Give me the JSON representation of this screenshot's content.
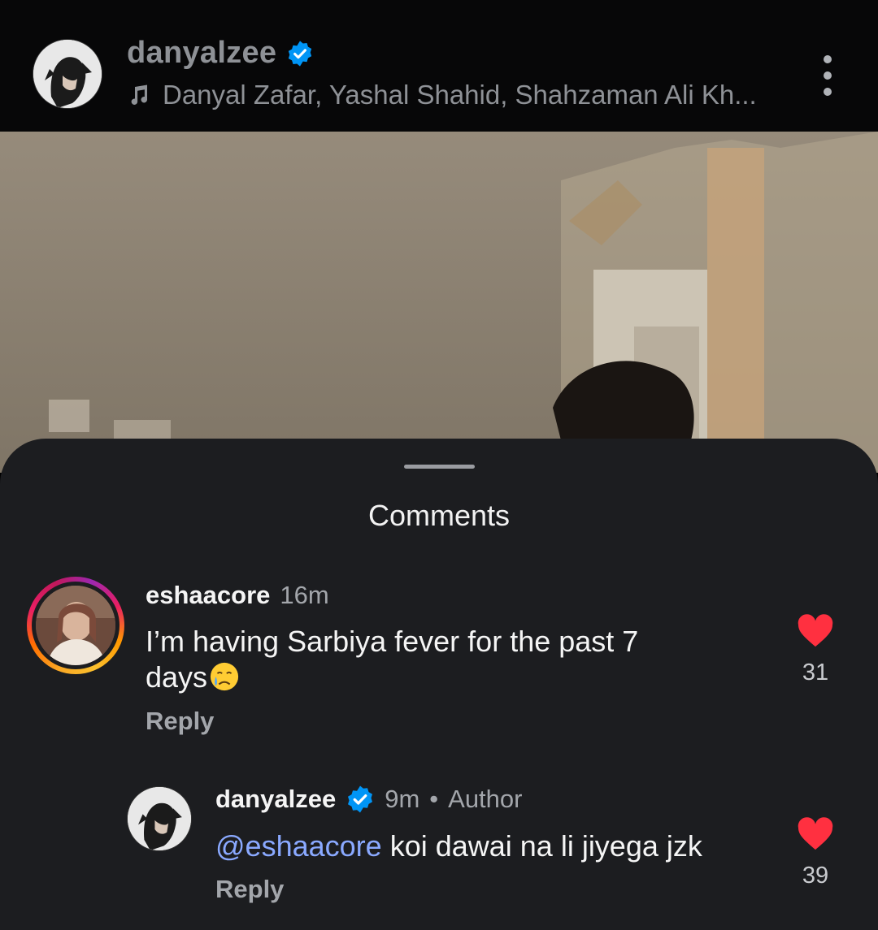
{
  "header": {
    "username": "danyalzee",
    "audio": "Danyal Zafar, Yashal Shahid, Shahzaman Ali Kh...",
    "more_icon": "more-vertical-icon"
  },
  "sheet": {
    "title": "Comments"
  },
  "comments": [
    {
      "username": "eshaacore",
      "time": "16m",
      "text_line1": "I’m having Sarbiya fever for the past 7",
      "text_line2": "days",
      "reply": "Reply",
      "likes": "31"
    },
    {
      "username": "danyalzee",
      "time": "9m",
      "separator": "•",
      "badge": "Author",
      "mention": "@eshaacore",
      "text": "koi dawai na li jiyega jzk",
      "reply": "Reply",
      "likes": "39"
    }
  ],
  "colors": {
    "accent_like": "#ff3040",
    "verified": "#0095f6",
    "mention": "#8aa9ff"
  }
}
